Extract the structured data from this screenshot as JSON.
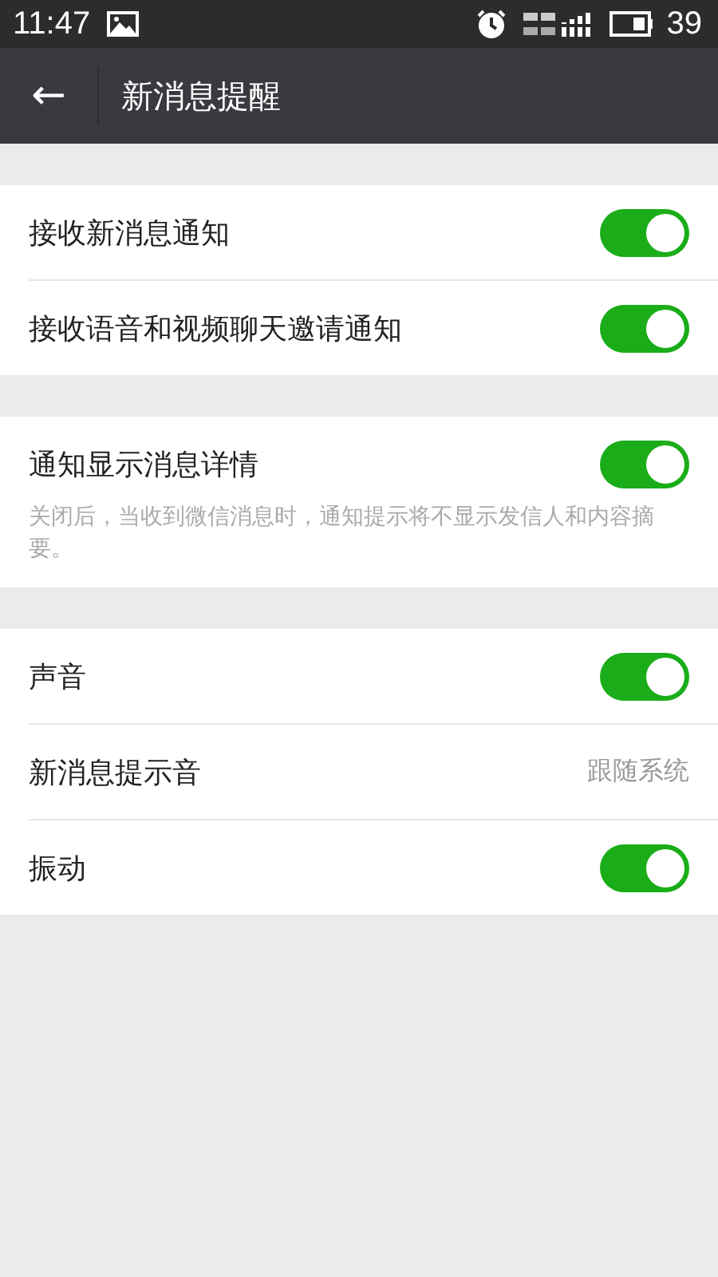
{
  "status_bar": {
    "time": "11:47",
    "battery": "39"
  },
  "app_bar": {
    "back_icon": "←",
    "title": "新消息提醒"
  },
  "groups": [
    {
      "items": [
        {
          "kind": "toggle",
          "label": "接收新消息通知",
          "on": true
        },
        {
          "kind": "toggle",
          "label": "接收语音和视频聊天邀请通知",
          "on": true
        }
      ]
    },
    {
      "items": [
        {
          "kind": "toggle",
          "label": "通知显示消息详情",
          "on": true,
          "description": "关闭后，当收到微信消息时，通知提示将不显示发信人和内容摘要。"
        }
      ]
    },
    {
      "items": [
        {
          "kind": "toggle",
          "label": "声音",
          "on": true
        },
        {
          "kind": "value",
          "label": "新消息提示音",
          "value": "跟随系统"
        },
        {
          "kind": "toggle",
          "label": "振动",
          "on": true
        }
      ]
    }
  ]
}
